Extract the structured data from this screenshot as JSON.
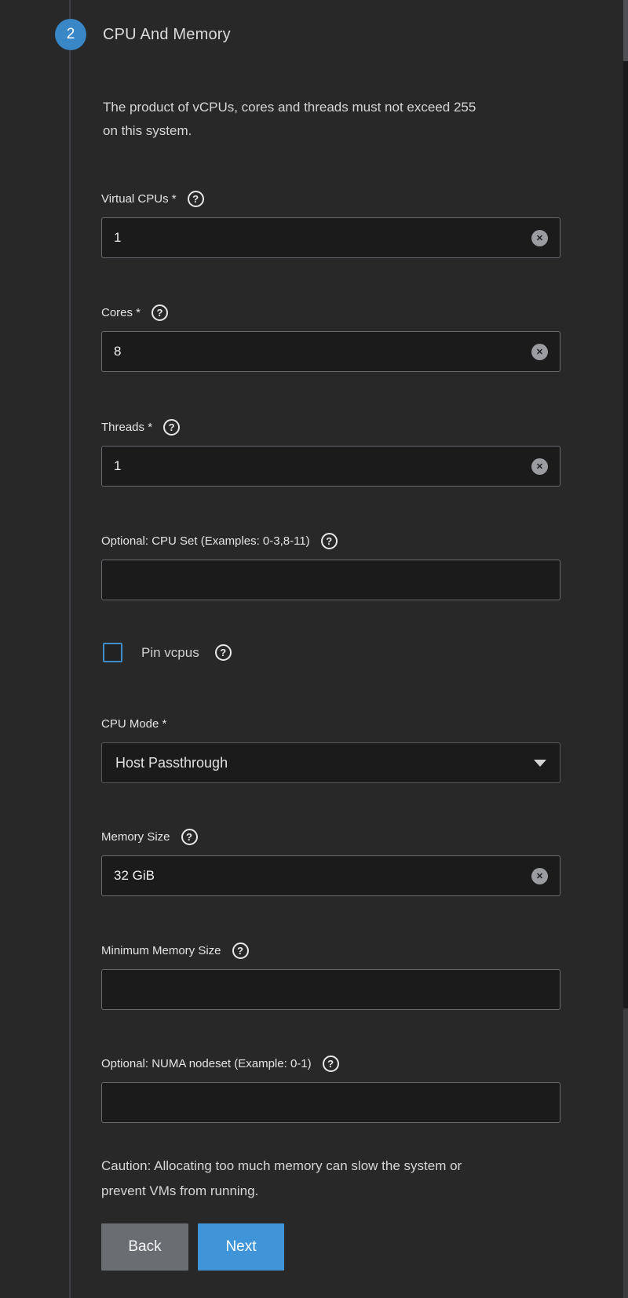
{
  "step": {
    "number": "2",
    "title": "CPU And Memory"
  },
  "description_lines": [
    "The product of vCPUs, cores and threads must not exceed 255",
    "on this system."
  ],
  "icons": {
    "help": "?",
    "clear": "✕"
  },
  "fields": [
    {
      "id": "vcpus",
      "label": "Virtual CPUs *",
      "value": "1"
    },
    {
      "id": "cores",
      "label": "Cores *",
      "value": "8"
    },
    {
      "id": "threads",
      "label": "Threads *",
      "value": "1"
    },
    {
      "id": "cpuset",
      "label": "Optional: CPU Set (Examples: 0-3,8-11)",
      "value": ""
    },
    {
      "id": "memory",
      "label": "Memory Size",
      "value": "32 GiB"
    },
    {
      "id": "minmem",
      "label": "Minimum Memory Size",
      "value": ""
    },
    {
      "id": "numa",
      "label": "Optional: NUMA nodeset (Example: 0-1)",
      "value": ""
    }
  ],
  "checkbox": {
    "label": "Pin vcpus",
    "checked": false
  },
  "select": {
    "label": "CPU Mode *",
    "value": "Host Passthrough"
  },
  "caution_lines": [
    "Caution: Allocating too much memory can slow the system or",
    "prevent VMs from running."
  ],
  "buttons": {
    "back": "Back",
    "next": "Next"
  },
  "colors": {
    "background": "#282828",
    "input_background": "#1b1b1b",
    "accent_blue": "#4094d8",
    "step_circle_blue": "#3a87c8",
    "checkbox_border_blue": "#3c8dc9",
    "back_button_gray": "#6a6e73"
  }
}
